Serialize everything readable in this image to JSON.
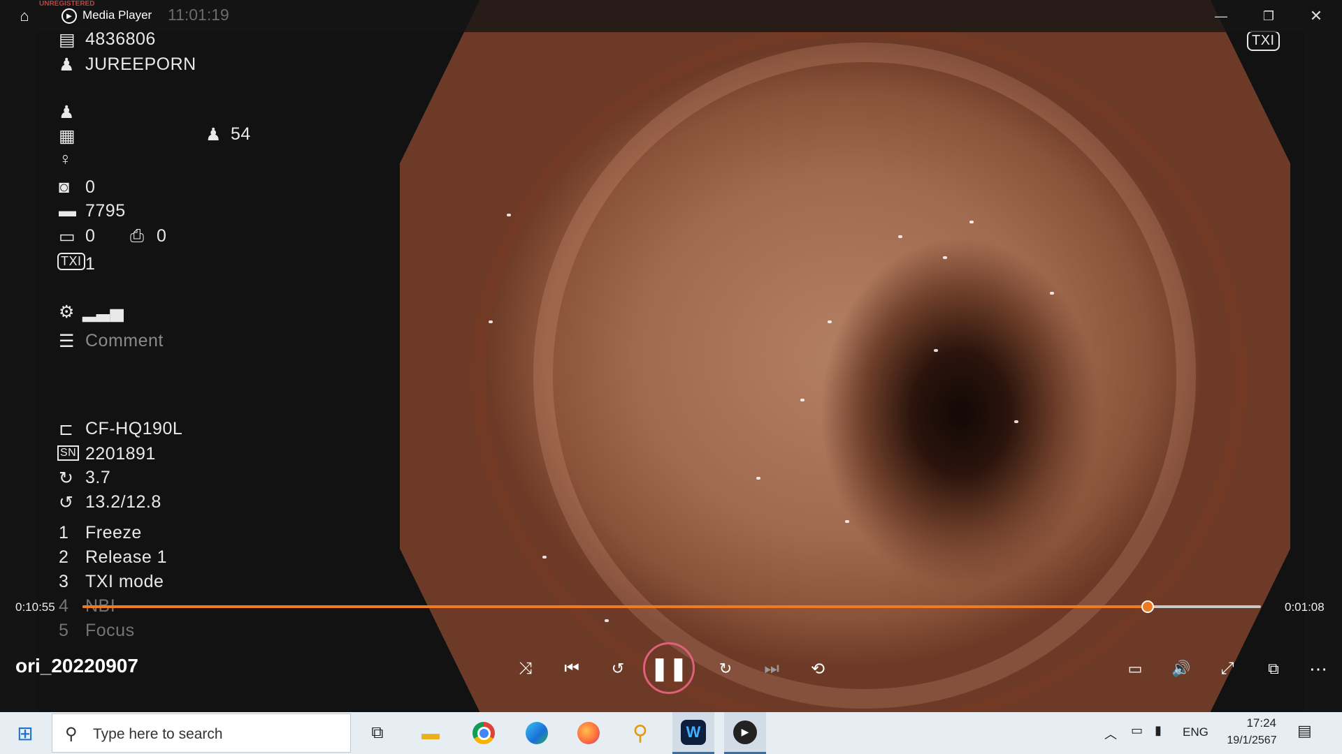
{
  "window": {
    "app_title": "Media Player",
    "watermark": "UNREGISTERED",
    "timestamp_text": "11:01:19"
  },
  "overlay": {
    "tag": "TXI",
    "patient_id": "4836806",
    "patient_name": "JUREEPORN",
    "age": "54",
    "camera_count": "0",
    "battery_value": "7795",
    "screen_count": "0",
    "cvp_count": "0",
    "txi_value": "1",
    "comment_placeholder": "Comment",
    "scope_model": "CF-HQ190L",
    "serial_number": "2201891",
    "rotation_value": "3.7",
    "ratio_value": "13.2/12.8",
    "buttons": [
      {
        "num": "1",
        "label": "Freeze"
      },
      {
        "num": "2",
        "label": "Release 1"
      },
      {
        "num": "3",
        "label": "TXI mode"
      },
      {
        "num": "4",
        "label": "NBI"
      },
      {
        "num": "5",
        "label": "Focus"
      }
    ]
  },
  "player": {
    "elapsed": "0:10:55",
    "remaining": "0:01:08",
    "progress": 0.904,
    "file_name": "ori_20220907",
    "accent": "#f07a22"
  },
  "taskbar": {
    "search_placeholder": "Type here to search",
    "language": "ENG",
    "time": "17:24",
    "date": "19/1/2567"
  }
}
